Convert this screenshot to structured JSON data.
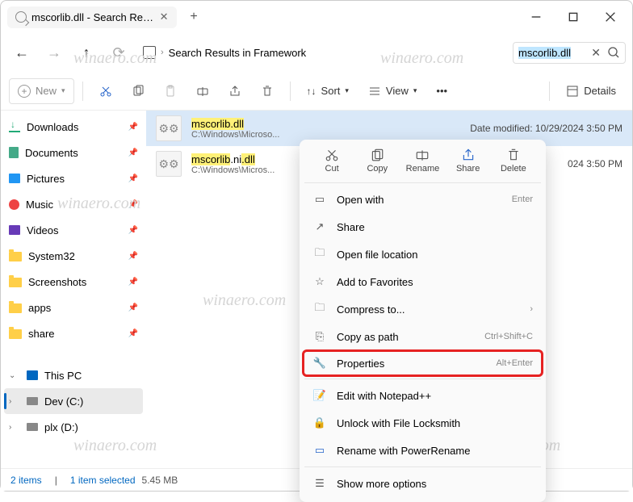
{
  "tab": {
    "title": "mscorlib.dll - Search Results in"
  },
  "breadcrumb": {
    "text": "Search Results in Framework"
  },
  "search": {
    "value": "mscorlib.dll"
  },
  "toolbar": {
    "new": "New",
    "sort": "Sort",
    "view": "View",
    "details": "Details"
  },
  "sidebar": {
    "items": [
      {
        "label": "Downloads",
        "type": "download",
        "pin": true
      },
      {
        "label": "Documents",
        "type": "doc",
        "pin": true
      },
      {
        "label": "Pictures",
        "type": "pic",
        "pin": true
      },
      {
        "label": "Music",
        "type": "music",
        "pin": true
      },
      {
        "label": "Videos",
        "type": "video",
        "pin": true
      },
      {
        "label": "System32",
        "type": "folder",
        "pin": true
      },
      {
        "label": "Screenshots",
        "type": "folder",
        "pin": true
      },
      {
        "label": "apps",
        "type": "folder",
        "pin": true
      },
      {
        "label": "share",
        "type": "folder",
        "pin": true
      }
    ],
    "thispc": "This PC",
    "drives": [
      {
        "label": "Dev (C:)"
      },
      {
        "label": "plx (D:)"
      }
    ]
  },
  "files": [
    {
      "name_pre": "mscorlib",
      "name_hl": ".dll",
      "path": "C:\\Windows\\Microso...",
      "date_label": "Date modified:",
      "date": "10/29/2024 3:50 PM"
    },
    {
      "name_pre": "mscorlib",
      "name_mid": ".ni",
      "name_hl": ".dll",
      "path": "C:\\Windows\\Micros...",
      "date_label": "",
      "date": "024 3:50 PM"
    }
  ],
  "context_menu": {
    "top": [
      {
        "label": "Cut"
      },
      {
        "label": "Copy"
      },
      {
        "label": "Rename"
      },
      {
        "label": "Share"
      },
      {
        "label": "Delete"
      }
    ],
    "items": [
      {
        "label": "Open with",
        "shortcut": "Enter"
      },
      {
        "label": "Share"
      },
      {
        "label": "Open file location"
      },
      {
        "label": "Add to Favorites"
      },
      {
        "label": "Compress to...",
        "chevron": true
      },
      {
        "label": "Copy as path",
        "shortcut": "Ctrl+Shift+C"
      },
      {
        "label": "Properties",
        "shortcut": "Alt+Enter",
        "highlight": true
      }
    ],
    "extra": [
      {
        "label": "Edit with Notepad++"
      },
      {
        "label": "Unlock with File Locksmith"
      },
      {
        "label": "Rename with PowerRename"
      }
    ],
    "more": "Show more options"
  },
  "status": {
    "count": "2 items",
    "selected": "1 item selected",
    "size": "5.45 MB"
  }
}
